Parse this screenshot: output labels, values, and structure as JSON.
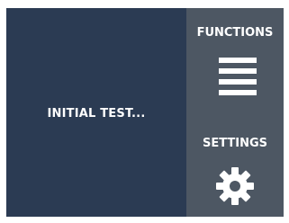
{
  "status": {
    "message": "INITIAL TEST..."
  },
  "side_menu": {
    "functions": {
      "label": "FUNCTIONS",
      "icon": "hamburger-menu-icon"
    },
    "settings": {
      "label": "SETTINGS",
      "icon": "gear-icon"
    }
  },
  "colors": {
    "main_background": "#2b3b53",
    "side_panel_background": "#4d5763",
    "text": "#ffffff"
  }
}
